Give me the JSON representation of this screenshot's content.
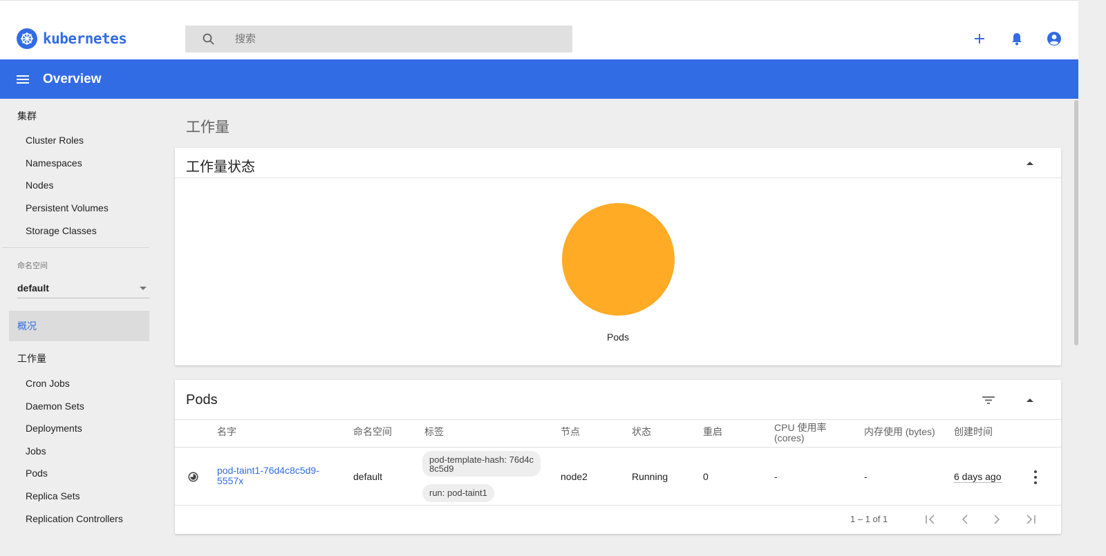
{
  "app": {
    "logo_text": "kubernetes",
    "search_placeholder": "搜索",
    "toolbar_title": "Overview"
  },
  "sidebar": {
    "cluster_header": "集群",
    "cluster_items": [
      "Cluster Roles",
      "Namespaces",
      "Nodes",
      "Persistent Volumes",
      "Storage Classes"
    ],
    "namespace_label": "命名空间",
    "namespace_value": "default",
    "overview_label": "概况",
    "workloads_header": "工作量",
    "workload_items": [
      "Cron Jobs",
      "Daemon Sets",
      "Deployments",
      "Jobs",
      "Pods",
      "Replica Sets",
      "Replication Controllers"
    ]
  },
  "main": {
    "page_title": "工作量",
    "status_card": {
      "title": "工作量状态",
      "chart_label": "Pods"
    },
    "pods_card": {
      "title": "Pods",
      "columns": {
        "name": "名字",
        "namespace": "命名空间",
        "labels": "标签",
        "node": "节点",
        "status": "状态",
        "restarts": "重启",
        "cpu": "CPU 使用率",
        "cpu_unit": "(cores)",
        "memory": "内存使用 (bytes)",
        "created": "创建时间"
      },
      "rows": [
        {
          "name_line1": "pod-taint1-76d4c8c5d9-",
          "name_line2": "5557x",
          "namespace": "default",
          "label_1_line1": "pod-template-hash: 76d4c",
          "label_1_line2": "8c5d9",
          "label_2": "run: pod-taint1",
          "node": "node2",
          "status": "Running",
          "restarts": "0",
          "cpu": "-",
          "memory": "-",
          "created": "6 days ago"
        }
      ],
      "pagination": "1 – 1 of 1"
    }
  },
  "chart_data": {
    "type": "pie",
    "categories": [
      "Pods"
    ],
    "values": [
      1
    ],
    "colors": [
      "#ffab26"
    ]
  },
  "colors": {
    "brand": "#326ce5",
    "pie": "#ffab26"
  }
}
